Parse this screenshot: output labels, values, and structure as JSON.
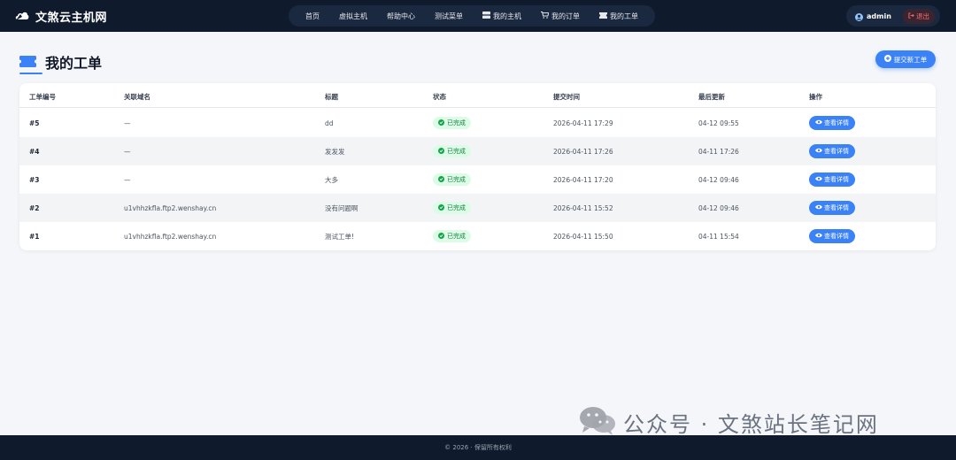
{
  "header": {
    "brand": "文煞云主机网",
    "nav": [
      {
        "label": "首页",
        "icon": ""
      },
      {
        "label": "虚拟主机",
        "icon": ""
      },
      {
        "label": "帮助中心",
        "icon": ""
      },
      {
        "label": "测试菜单",
        "icon": ""
      },
      {
        "label": "我的主机",
        "icon": "server-icon"
      },
      {
        "label": "我的订单",
        "icon": "cart-icon"
      },
      {
        "label": "我的工单",
        "icon": "ticket-icon"
      }
    ],
    "user": "admin",
    "logout": "退出"
  },
  "page": {
    "title": "我的工单",
    "new_button": "提交新工单"
  },
  "table": {
    "headers": [
      "工单编号",
      "关联域名",
      "标题",
      "状态",
      "提交时间",
      "最后更新",
      "操作"
    ],
    "rows": [
      {
        "id": "#5",
        "domain": "—",
        "title": "dd",
        "status": "已完成",
        "created": "2026-04-11 17:29",
        "updated": "04-12 09:55",
        "action": "查看详情"
      },
      {
        "id": "#4",
        "domain": "—",
        "title": "发发发",
        "status": "已完成",
        "created": "2026-04-11 17:26",
        "updated": "04-11 17:26",
        "action": "查看详情"
      },
      {
        "id": "#3",
        "domain": "—",
        "title": "大多",
        "status": "已完成",
        "created": "2026-04-11 17:20",
        "updated": "04-12 09:46",
        "action": "查看详情"
      },
      {
        "id": "#2",
        "domain": "u1vhhzkfla.ftp2.wenshay.cn",
        "title": "没有问题啊",
        "status": "已完成",
        "created": "2026-04-11 15:52",
        "updated": "04-12 09:46",
        "action": "查看详情"
      },
      {
        "id": "#1",
        "domain": "u1vhhzkfla.ftp2.wenshay.cn",
        "title": "测试工单!",
        "status": "已完成",
        "created": "2026-04-11 15:50",
        "updated": "04-11 15:54",
        "action": "查看详情"
      }
    ]
  },
  "footer": {
    "text": "© 2026 · 保留所有权利"
  },
  "watermark": {
    "text": "公众号 · 文煞站长笔记网"
  },
  "colors": {
    "header_bg": "#0f1b2d",
    "accent": "#3b82f6",
    "status_bg": "#dcfce7",
    "status_text": "#15803d"
  }
}
